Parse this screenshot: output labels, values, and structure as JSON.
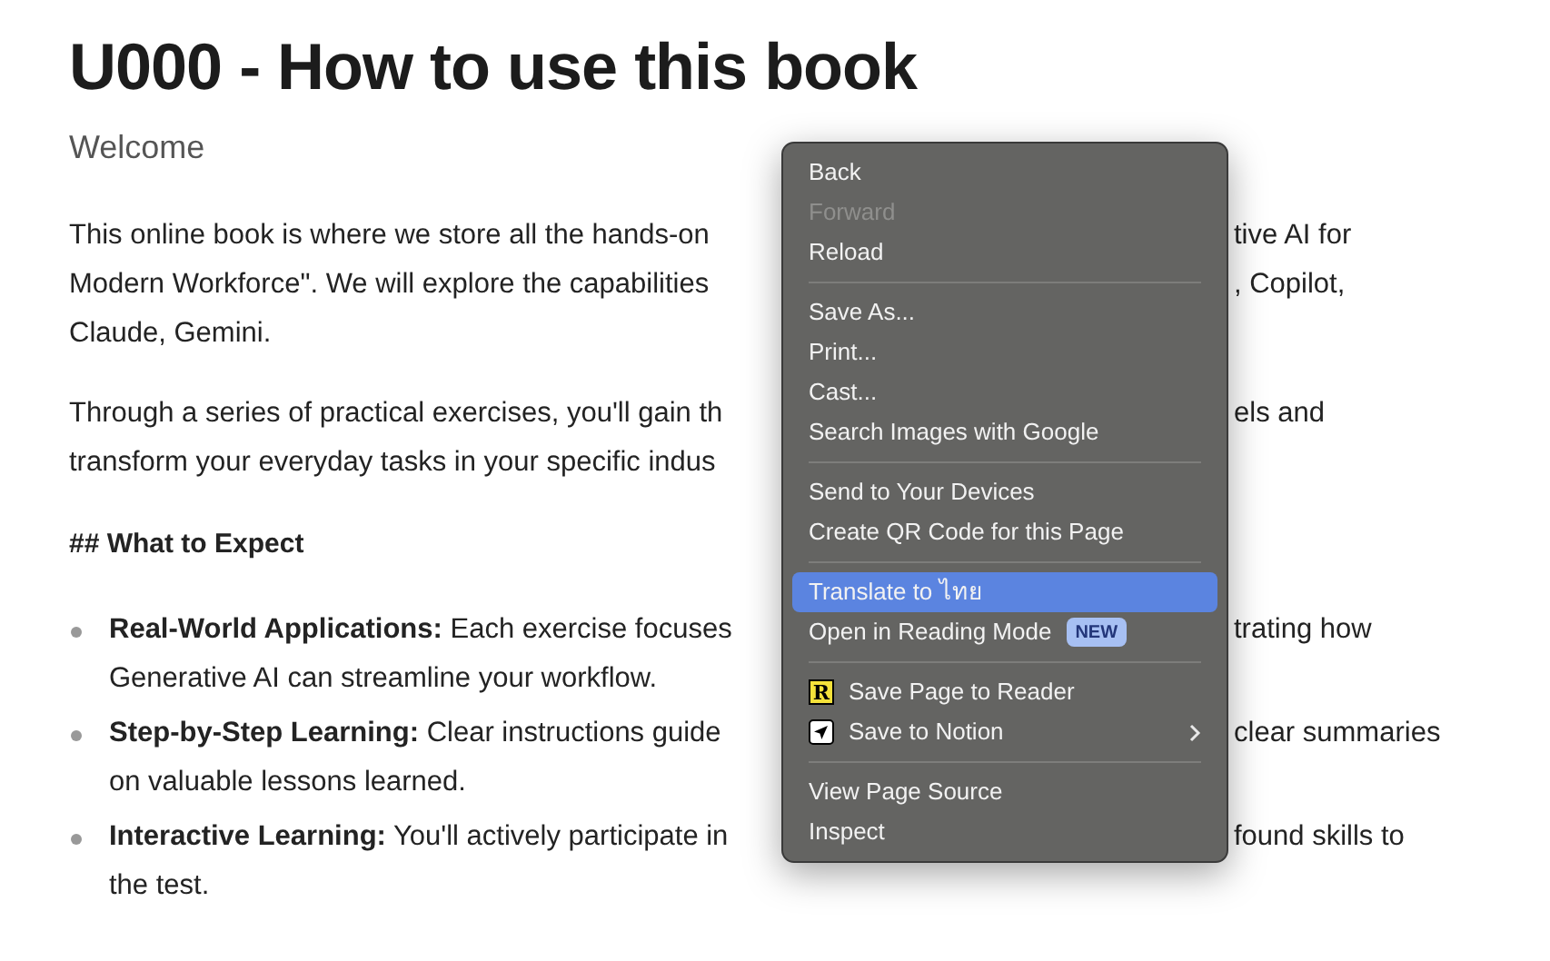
{
  "title": "U000 - How to use this book",
  "subtitle": "Welcome",
  "paragraphs": [
    {
      "lines": [
        {
          "left": "This online book is where we store all the hands-on",
          "right": "tive AI for"
        },
        {
          "left": "Modern Workforce\". We will explore the capabilities",
          "right": ", Copilot,"
        },
        {
          "left": "Claude, Gemini."
        }
      ]
    },
    {
      "lines": [
        {
          "left": "Through a series of practical exercises, you'll gain th",
          "right": "els and"
        },
        {
          "left": "transform your everyday tasks in your specific indus"
        }
      ]
    }
  ],
  "heading": "## What to Expect",
  "bullets": [
    {
      "lines": [
        {
          "left": "**Real-World Applications:** Each exercise focuses",
          "right": "trating how"
        },
        {
          "left": "Generative AI can streamline your workflow."
        }
      ]
    },
    {
      "lines": [
        {
          "left": "**Step-by-Step Learning:** Clear instructions guide",
          "right": "clear summaries"
        },
        {
          "left": "on valuable lessons learned."
        }
      ]
    },
    {
      "lines": [
        {
          "left": "**Interactive Learning:** You'll actively participate in",
          "right": "found skills to"
        },
        {
          "left": "the test."
        }
      ]
    }
  ],
  "context_menu": {
    "items": [
      {
        "kind": "item",
        "label": "Back",
        "disabled": false,
        "selected": false
      },
      {
        "kind": "item",
        "label": "Forward",
        "disabled": true,
        "selected": false
      },
      {
        "kind": "item",
        "label": "Reload",
        "disabled": false,
        "selected": false
      },
      {
        "kind": "separator"
      },
      {
        "kind": "item",
        "label": "Save As...",
        "disabled": false,
        "selected": false
      },
      {
        "kind": "item",
        "label": "Print...",
        "disabled": false,
        "selected": false
      },
      {
        "kind": "item",
        "label": "Cast...",
        "disabled": false,
        "selected": false
      },
      {
        "kind": "item",
        "label": "Search Images with Google",
        "disabled": false,
        "selected": false
      },
      {
        "kind": "separator"
      },
      {
        "kind": "item",
        "label": "Send to Your Devices",
        "disabled": false,
        "selected": false
      },
      {
        "kind": "item",
        "label": "Create QR Code for this Page",
        "disabled": false,
        "selected": false
      },
      {
        "kind": "separator"
      },
      {
        "kind": "item",
        "label": "Translate to ไทย",
        "disabled": false,
        "selected": true
      },
      {
        "kind": "item",
        "label": "Open in Reading Mode",
        "badge": "NEW",
        "disabled": false,
        "selected": false
      },
      {
        "kind": "separator"
      },
      {
        "kind": "item",
        "label": "Save Page to Reader",
        "icon": {
          "kind": "letter",
          "text": "R"
        },
        "disabled": false,
        "selected": false
      },
      {
        "kind": "item",
        "label": "Save to Notion",
        "icon": {
          "kind": "plane"
        },
        "submenu": true,
        "disabled": false,
        "selected": false
      },
      {
        "kind": "separator"
      },
      {
        "kind": "item",
        "label": "View Page Source",
        "disabled": false,
        "selected": false
      },
      {
        "kind": "item",
        "label": "Inspect",
        "disabled": false,
        "selected": false
      }
    ]
  }
}
